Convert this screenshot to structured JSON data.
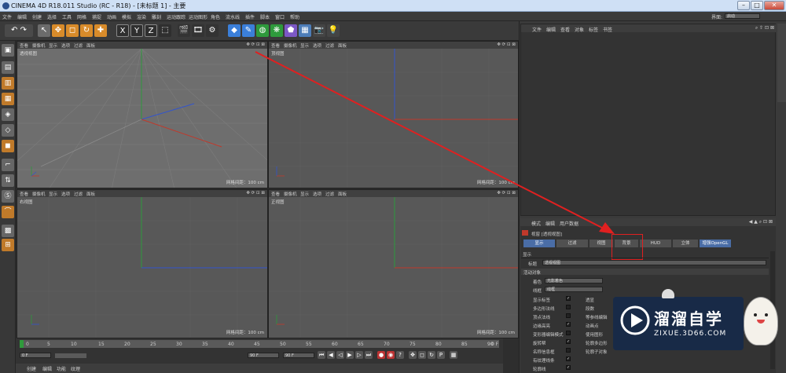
{
  "window": {
    "title": "CINEMA 4D R18.011 Studio (RC - R18) - [未标题 1] - 主要"
  },
  "menubar": {
    "items": [
      "文件",
      "编辑",
      "创建",
      "选择",
      "工具",
      "网格",
      "捕捉",
      "动画",
      "模拟",
      "渲染",
      "雕刻",
      "运动跟踪",
      "运动图形",
      "角色",
      "流水线",
      "插件",
      "脚本",
      "窗口",
      "帮助"
    ],
    "layout_label": "界面:",
    "layout_value": "启动"
  },
  "viewports": [
    {
      "name": "透视视图",
      "menu": [
        "查看",
        "摄像机",
        "显示",
        "选项",
        "过滤",
        "面板"
      ],
      "grid": "网格间距：100 cm"
    },
    {
      "name": "顶视图",
      "menu": [
        "查看",
        "摄像机",
        "显示",
        "选项",
        "过滤",
        "面板"
      ],
      "grid": "网格间距：100 cm"
    },
    {
      "name": "右视图",
      "menu": [
        "查看",
        "摄像机",
        "显示",
        "选项",
        "过滤",
        "面板"
      ],
      "grid": "网格间距：100 cm"
    },
    {
      "name": "正视图",
      "menu": [
        "查看",
        "摄像机",
        "显示",
        "选项",
        "过滤",
        "面板"
      ],
      "grid": "网格间距：100 cm"
    }
  ],
  "timeline": {
    "ticks": [
      "0",
      "5",
      "10",
      "15",
      "20",
      "25",
      "30",
      "35",
      "40",
      "45",
      "50",
      "55",
      "60",
      "65",
      "70",
      "75",
      "80",
      "85",
      "90"
    ],
    "frame_end_marker": "0 F",
    "start": "0 F",
    "current": "0 F",
    "end": "90 F",
    "end2": "90 F"
  },
  "bottom_menu": [
    "创建",
    "编辑",
    "功能",
    "纹理"
  ],
  "object_manager": {
    "menu": [
      "文件",
      "编辑",
      "查看",
      "对象",
      "标签",
      "书签"
    ]
  },
  "attributes": {
    "menu": [
      "模式",
      "编辑",
      "用户数据"
    ],
    "title": "视窗 [透视视图]",
    "tabs": [
      "显示",
      "过滤",
      "视图",
      "背景",
      "HUD",
      "立体",
      "增强OpenGL"
    ],
    "section": "显示",
    "name_label": "标题",
    "name_value": "透视视图",
    "group": "活动对象",
    "shading_label": "着色",
    "shading_value": "光影着色",
    "style_label": "线框",
    "style_value": "线框",
    "options_left": [
      "显示标签",
      "多边形法线",
      "顶点法线",
      "边缘高亮",
      "变形器编辑模式",
      "旋转帮",
      "名称信息框",
      "有纹理线条",
      "轮廓线"
    ],
    "options_right": [
      "透显",
      "段数",
      "等参线编辑",
      "动画点",
      "使用图形",
      "轮廓多边形",
      "轮廓子对象"
    ]
  },
  "watermark": {
    "brand": "溜溜自学",
    "url": "ZIXUE.3D66.COM"
  },
  "colors": {
    "accent": "#4a6da6",
    "arrow": "#e02020",
    "axis_red": "#c0392b",
    "axis_green": "#27ae60",
    "axis_blue": "#3355cc"
  }
}
